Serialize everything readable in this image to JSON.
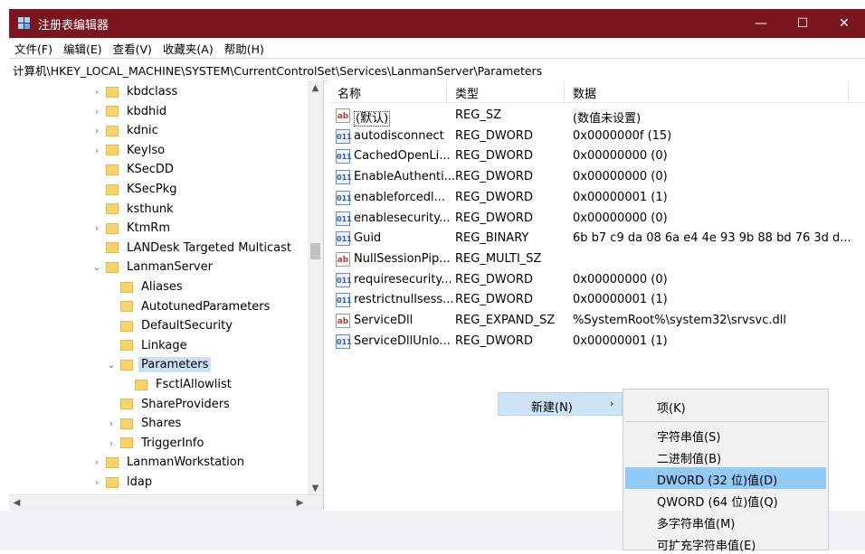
{
  "window": {
    "title": "注册表编辑器",
    "min": "—",
    "max": "☐",
    "close": "✕"
  },
  "menu": [
    "文件(F)",
    "编辑(E)",
    "查看(V)",
    "收藏夹(A)",
    "帮助(H)"
  ],
  "address": "计算机\\HKEY_LOCAL_MACHINE\\SYSTEM\\CurrentControlSet\\Services\\LanmanServer\\Parameters",
  "tree": [
    {
      "label": "kbdclass",
      "depth": 0,
      "expander": "›"
    },
    {
      "label": "kbdhid",
      "depth": 0,
      "expander": "›"
    },
    {
      "label": "kdnic",
      "depth": 0,
      "expander": "›"
    },
    {
      "label": "KeyIso",
      "depth": 0,
      "expander": "›"
    },
    {
      "label": "KSecDD",
      "depth": 0,
      "expander": ""
    },
    {
      "label": "KSecPkg",
      "depth": 0,
      "expander": ""
    },
    {
      "label": "ksthunk",
      "depth": 0,
      "expander": ""
    },
    {
      "label": "KtmRm",
      "depth": 0,
      "expander": "›"
    },
    {
      "label": "LANDesk Targeted Multicast",
      "depth": 0,
      "expander": ""
    },
    {
      "label": "LanmanServer",
      "depth": 0,
      "expander": "⌄"
    },
    {
      "label": "Aliases",
      "depth": 1,
      "expander": ""
    },
    {
      "label": "AutotunedParameters",
      "depth": 1,
      "expander": ""
    },
    {
      "label": "DefaultSecurity",
      "depth": 1,
      "expander": ""
    },
    {
      "label": "Linkage",
      "depth": 1,
      "expander": ""
    },
    {
      "label": "Parameters",
      "depth": 1,
      "expander": "⌄",
      "selected": true
    },
    {
      "label": "FsctlAllowlist",
      "depth": 2,
      "expander": ""
    },
    {
      "label": "ShareProviders",
      "depth": 1,
      "expander": ""
    },
    {
      "label": "Shares",
      "depth": 1,
      "expander": "›"
    },
    {
      "label": "TriggerInfo",
      "depth": 1,
      "expander": "›"
    },
    {
      "label": "LanmanWorkstation",
      "depth": 0,
      "expander": "›"
    },
    {
      "label": "ldap",
      "depth": 0,
      "expander": "›"
    }
  ],
  "columns": [
    "名称",
    "类型",
    "数据"
  ],
  "values": [
    {
      "icon": "string-value-icon",
      "glyph": "ab",
      "name": "(默认)",
      "type": "REG_SZ",
      "data": "(数值未设置)"
    },
    {
      "icon": "binary-value-icon",
      "glyph": "011",
      "name": "autodisconnect",
      "type": "REG_DWORD",
      "data": "0x0000000f (15)"
    },
    {
      "icon": "binary-value-icon",
      "glyph": "011",
      "name": "CachedOpenLi...",
      "type": "REG_DWORD",
      "data": "0x00000000 (0)"
    },
    {
      "icon": "binary-value-icon",
      "glyph": "011",
      "name": "EnableAuthenti...",
      "type": "REG_DWORD",
      "data": "0x00000000 (0)"
    },
    {
      "icon": "binary-value-icon",
      "glyph": "011",
      "name": "enableforcedl...",
      "type": "REG_DWORD",
      "data": "0x00000001 (1)"
    },
    {
      "icon": "binary-value-icon",
      "glyph": "011",
      "name": "enablesecurity...",
      "type": "REG_DWORD",
      "data": "0x00000000 (0)"
    },
    {
      "icon": "binary-value-icon",
      "glyph": "011",
      "name": "Guid",
      "type": "REG_BINARY",
      "data": "6b b7 c9 da 08 6a e4 4e 93 9b 88 bd 76 3d d..."
    },
    {
      "icon": "string-value-icon",
      "glyph": "ab",
      "name": "NullSessionPip...",
      "type": "REG_MULTI_SZ",
      "data": ""
    },
    {
      "icon": "binary-value-icon",
      "glyph": "011",
      "name": "requiresecurity...",
      "type": "REG_DWORD",
      "data": "0x00000000 (0)"
    },
    {
      "icon": "binary-value-icon",
      "glyph": "011",
      "name": "restrictnullsess...",
      "type": "REG_DWORD",
      "data": "0x00000001 (1)"
    },
    {
      "icon": "string-value-icon",
      "glyph": "ab",
      "name": "ServiceDll",
      "type": "REG_EXPAND_SZ",
      "data": "%SystemRoot%\\system32\\srvsvc.dll"
    },
    {
      "icon": "binary-value-icon",
      "glyph": "011",
      "name": "ServiceDllUnlo...",
      "type": "REG_DWORD",
      "data": "0x00000001 (1)"
    }
  ],
  "context_menu": {
    "new_label": "新建(N)",
    "arrow": "›"
  },
  "submenu": [
    {
      "label": "项(K)"
    },
    {
      "label": "字符串值(S)"
    },
    {
      "label": "二进制值(B)"
    },
    {
      "label": "DWORD (32 位)值(D)",
      "highlighted": true
    },
    {
      "label": "QWORD (64 位)值(Q)"
    },
    {
      "label": "多字符串值(M)"
    },
    {
      "label": "可扩充字符串值(E)"
    }
  ],
  "colors": {
    "titlebar": "#7a1620",
    "selection": "#cce0f5",
    "menu_highlight": "#91c9f7"
  }
}
